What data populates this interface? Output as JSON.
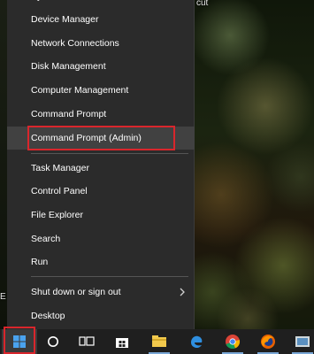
{
  "desktop": {
    "top_label_fragment": "cut",
    "left_label_fragment": "E"
  },
  "menu": {
    "partial_top_label": "Sy",
    "items": [
      {
        "label": "Device Manager"
      },
      {
        "label": "Network Connections"
      },
      {
        "label": "Disk Management"
      },
      {
        "label": "Computer Management"
      },
      {
        "label": "Command Prompt"
      },
      {
        "label": "Command Prompt (Admin)"
      },
      {
        "label": "Task Manager"
      },
      {
        "label": "Control Panel"
      },
      {
        "label": "File Explorer"
      },
      {
        "label": "Search"
      },
      {
        "label": "Run"
      },
      {
        "label": "Shut down or sign out"
      },
      {
        "label": "Desktop"
      }
    ],
    "hovered_item": "Command Prompt (Admin)",
    "highlight_color": "#d9262c",
    "background_color": "#2b2b2b"
  },
  "taskbar": {
    "items": [
      {
        "icon": "windows-start-icon"
      },
      {
        "icon": "cortana-circle-icon"
      },
      {
        "icon": "task-view-icon"
      },
      {
        "icon": "windows-store-icon"
      },
      {
        "icon": "folder-icon"
      },
      {
        "icon": "edge-icon"
      },
      {
        "icon": "chrome-icon"
      },
      {
        "icon": "firefox-icon"
      },
      {
        "icon": "misc-app-icon"
      }
    ]
  }
}
